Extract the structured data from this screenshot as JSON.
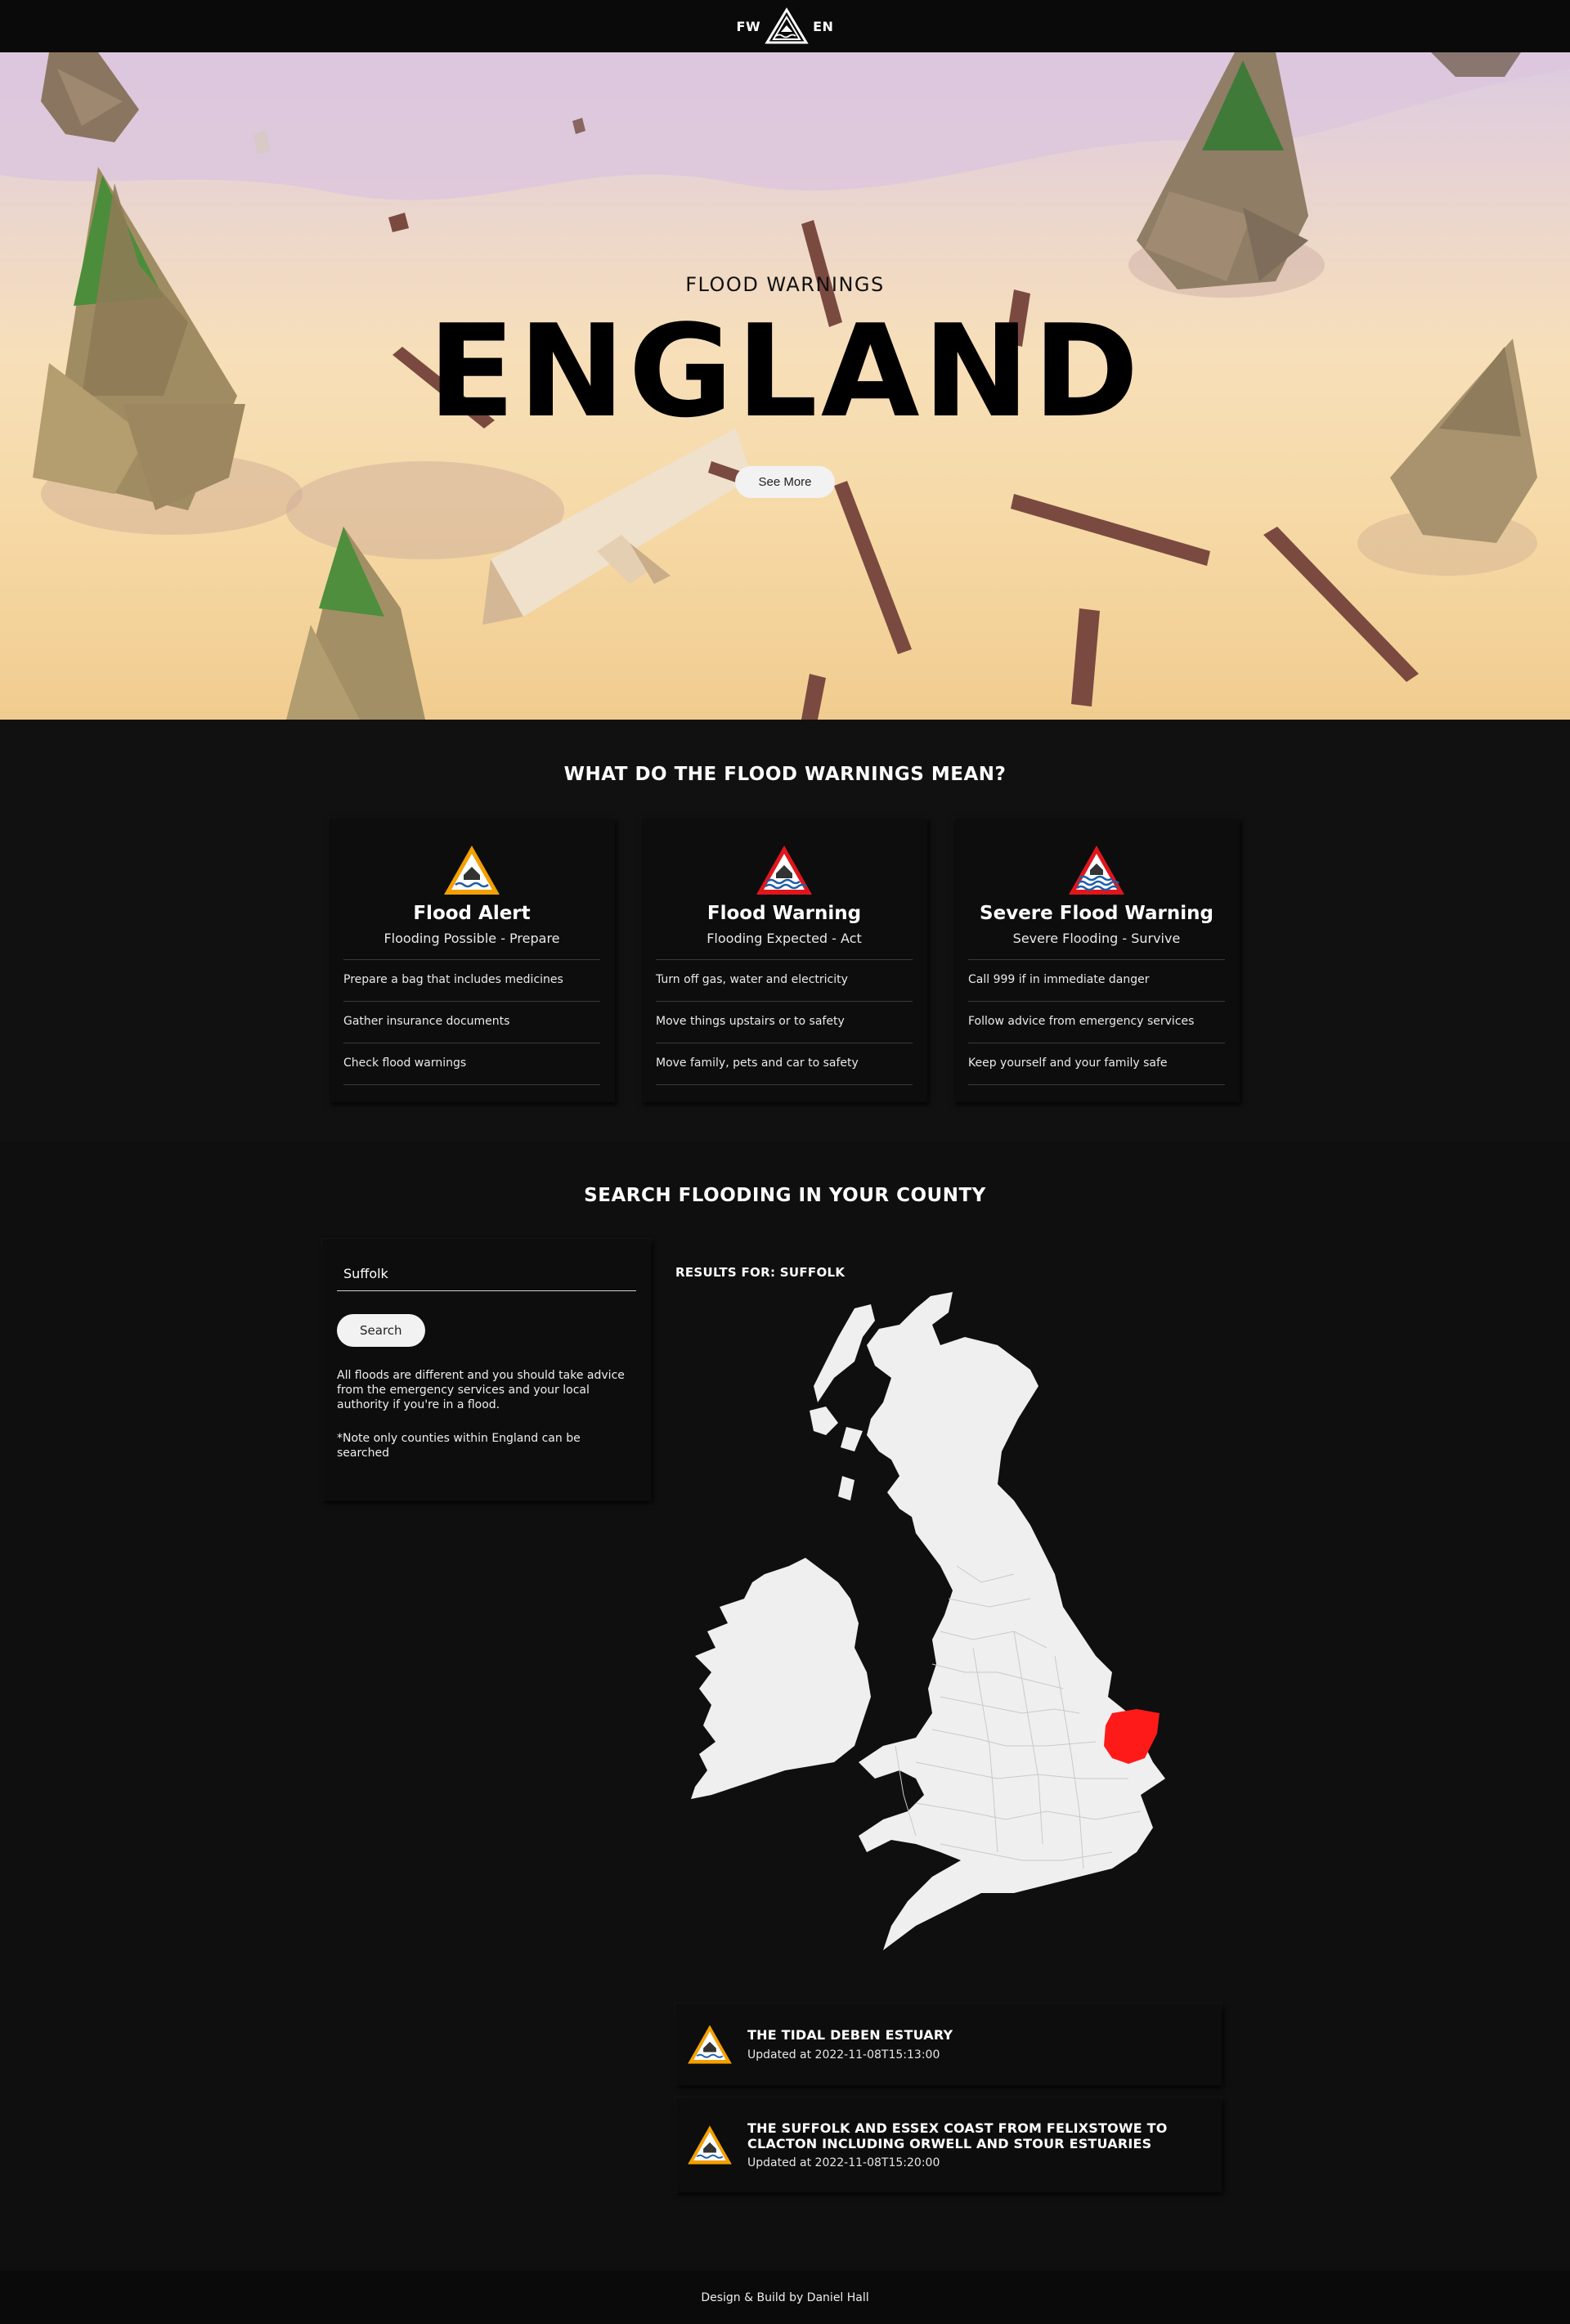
{
  "header": {
    "left_text": "FW",
    "right_text": "EN",
    "logo_icon": "flood-triangle-logo-icon"
  },
  "hero": {
    "subtitle": "FLOOD WARNINGS",
    "title": "ENGLAND",
    "button_label": "See More"
  },
  "meanings": {
    "title": "WHAT DO THE FLOOD WARNINGS MEAN?",
    "cards": [
      {
        "icon": "flood-alert-icon",
        "icon_color": "#f0a000",
        "title": "Flood Alert",
        "subtitle": "Flooding Possible - Prepare",
        "items": [
          "Prepare a bag that includes medicines",
          "Gather insurance documents",
          "Check flood warnings"
        ]
      },
      {
        "icon": "flood-warning-icon",
        "icon_color": "#e0161c",
        "title": "Flood Warning",
        "subtitle": "Flooding Expected - Act",
        "items": [
          "Turn off gas, water and electricity",
          "Move things upstairs or to safety",
          "Move family, pets and car to safety"
        ]
      },
      {
        "icon": "severe-flood-warning-icon",
        "icon_color": "#e0161c",
        "title": "Severe Flood Warning",
        "subtitle": "Severe Flooding - Survive",
        "items": [
          "Call 999 if in immediate danger",
          "Follow advice from emergency services",
          "Keep yourself and your family safe"
        ]
      }
    ]
  },
  "search": {
    "title": "SEARCH FLOODING IN YOUR COUNTY",
    "input_value": "Suffolk",
    "button_label": "Search",
    "note": "All floods are different and you should take advice from the emergency services and your local authority if you're in a flood.",
    "note2": "*Note only counties within England can be searched",
    "results_title": "RESULTS FOR: SUFFOLK",
    "highlight_color": "#ff1a1a",
    "results": [
      {
        "icon": "flood-alert-icon",
        "title": "THE TIDAL DEBEN ESTUARY",
        "updated": "Updated at 2022-11-08T15:13:00"
      },
      {
        "icon": "flood-alert-icon",
        "title": "THE SUFFOLK AND ESSEX COAST FROM FELIXSTOWE TO CLACTON INCLUDING ORWELL AND STOUR ESTUARIES",
        "updated": "Updated at 2022-11-08T15:20:00"
      }
    ]
  },
  "footer": {
    "text": "Design & Build by Daniel Hall"
  }
}
